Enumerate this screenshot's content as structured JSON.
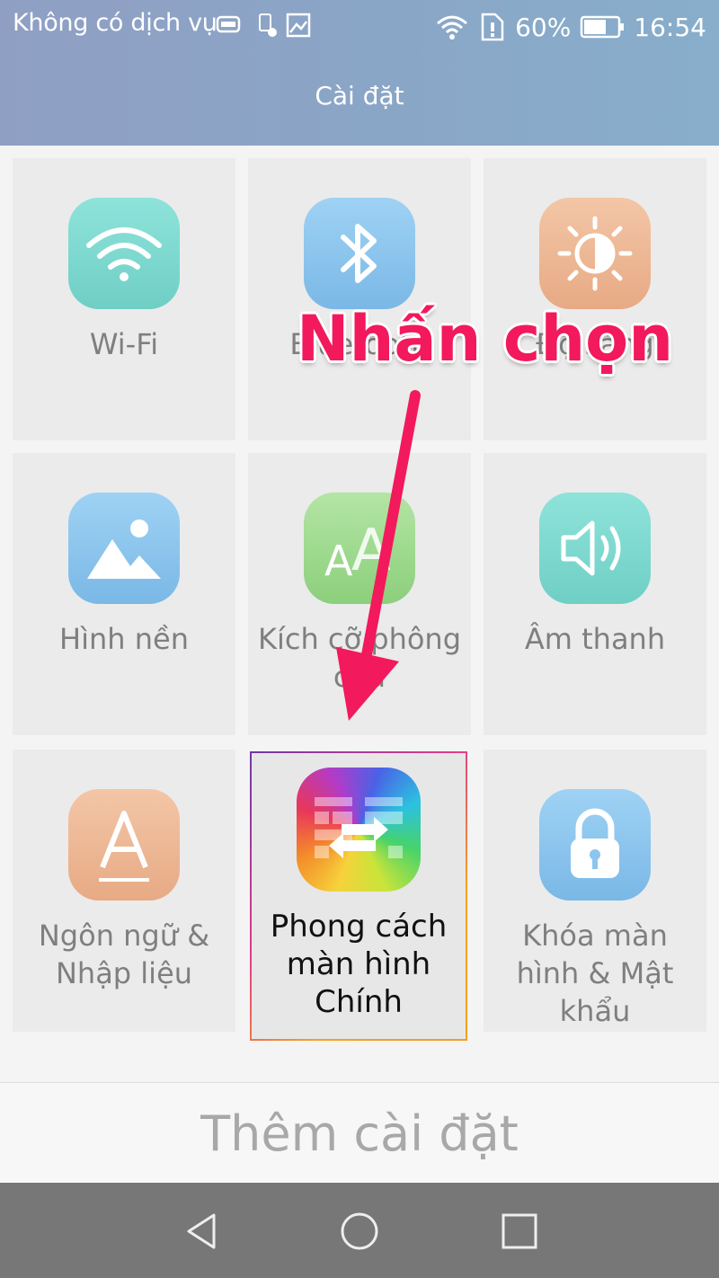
{
  "status_bar": {
    "carrier": "Không có dịch vụ",
    "battery": "60%",
    "time": "16:54"
  },
  "header": {
    "title": "Cài đặt"
  },
  "tiles": [
    {
      "label": "Wi-Fi",
      "icon": "wifi-icon",
      "color": "#7ed8d0"
    },
    {
      "label": "Bluetooth",
      "icon": "bluetooth-icon",
      "color": "#8cc6ee"
    },
    {
      "label": "Độ sáng",
      "icon": "brightness-icon",
      "color": "#eebb98"
    },
    {
      "label": "Hình nền",
      "icon": "wallpaper-icon",
      "color": "#8cc6ee"
    },
    {
      "label": "Kích cỡ phông chữ",
      "icon": "font-size-icon",
      "color": "#9fd890"
    },
    {
      "label": "Âm thanh",
      "icon": "sound-icon",
      "color": "#7ed8d0"
    },
    {
      "label": "Ngôn ngữ & Nhập liệu",
      "icon": "language-icon",
      "color": "#eebb98"
    },
    {
      "label": "Phong cách màn hình Chính",
      "icon": "home-screen-style-icon",
      "color": "#c05ac0"
    },
    {
      "label": "Khóa màn hình & Mật khẩu",
      "icon": "lock-icon",
      "color": "#8cc6ee"
    }
  ],
  "more_settings": "Thêm cài đặt",
  "annotation": {
    "text": "Nhấn chọn",
    "color": "#f2195c"
  }
}
